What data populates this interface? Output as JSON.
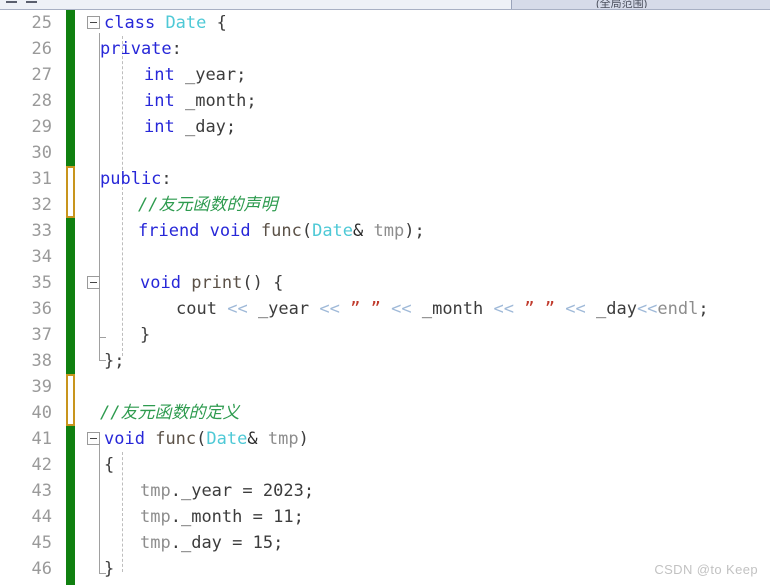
{
  "app": {
    "kind": "code-editor",
    "language": "C++",
    "watermark": "CSDN @to Keep"
  },
  "top_chrome": {
    "combo_ghost_text": "(全局范围)"
  },
  "colors": {
    "background": "#ffffff",
    "line_number": "#9a9a9a",
    "keyword": "#2727d8",
    "type": "#4ec9d6",
    "comment": "#2e9b4f",
    "string": "#c0392b",
    "operator_shift": "#9fb9d8",
    "function": "#5b5147",
    "identifier": "#3c3c3c",
    "changebar_saved": "#108010",
    "changebar_pending": "#c8951d",
    "indent_guide": "#bdbdbd",
    "watermark": "#c2c2c2"
  },
  "gutter": {
    "first_line": 25,
    "last_line": 46,
    "line_numbers": [
      25,
      26,
      27,
      28,
      29,
      30,
      31,
      32,
      33,
      34,
      35,
      36,
      37,
      38,
      39,
      40,
      41,
      42,
      43,
      44,
      45,
      46
    ]
  },
  "fold_markers": [
    {
      "line": 25,
      "state": "expanded",
      "glyph": "minus-box"
    },
    {
      "line": 35,
      "state": "expanded",
      "glyph": "minus-box"
    },
    {
      "line": 41,
      "state": "expanded",
      "glyph": "minus-box"
    }
  ],
  "change_bars": [
    {
      "from_line": 25,
      "to_line": 30,
      "state": "saved"
    },
    {
      "from_line": 31,
      "to_line": 32,
      "state": "pending"
    },
    {
      "from_line": 33,
      "to_line": 38,
      "state": "saved"
    },
    {
      "from_line": 39,
      "to_line": 40,
      "state": "pending"
    },
    {
      "from_line": 41,
      "to_line": 46,
      "state": "saved"
    }
  ],
  "lines": [
    {
      "n": 25,
      "text": "class Date {"
    },
    {
      "n": 26,
      "text": "private:"
    },
    {
      "n": 27,
      "text": "    int _year;"
    },
    {
      "n": 28,
      "text": "    int _month;"
    },
    {
      "n": 29,
      "text": "    int _day;"
    },
    {
      "n": 30,
      "text": ""
    },
    {
      "n": 31,
      "text": "public:"
    },
    {
      "n": 32,
      "text": "    //友元函数的声明"
    },
    {
      "n": 33,
      "text": "    friend void func(Date& tmp);"
    },
    {
      "n": 34,
      "text": ""
    },
    {
      "n": 35,
      "text": "    void print() {"
    },
    {
      "n": 36,
      "text": "        cout << _year << \" \" << _month << \" \" << _day<<endl;"
    },
    {
      "n": 37,
      "text": "    }"
    },
    {
      "n": 38,
      "text": "};"
    },
    {
      "n": 39,
      "text": ""
    },
    {
      "n": 40,
      "text": "//友元函数的定义"
    },
    {
      "n": 41,
      "text": "void func(Date& tmp)"
    },
    {
      "n": 42,
      "text": "{"
    },
    {
      "n": 43,
      "text": "    tmp._year = 2023;"
    },
    {
      "n": 44,
      "text": "    tmp._month = 11;"
    },
    {
      "n": 45,
      "text": "    tmp._day = 15;"
    },
    {
      "n": 46,
      "text": "}"
    }
  ],
  "tokens": {
    "kw_class": "class",
    "kw_private": "private",
    "kw_public": "public",
    "kw_int": "int",
    "kw_void": "void",
    "kw_friend": "friend",
    "type_Date": "Date",
    "fn_func": "func",
    "fn_print": "print",
    "id_cout": "cout",
    "id_endl": "endl",
    "id_tmp": "tmp",
    "field_year": "_year",
    "field_month": "_month",
    "field_day": "_day",
    "op_shift": "<<",
    "quote_open": "”",
    "quote_close": "”",
    "num_2023": "2023",
    "num_11": "11",
    "num_15": "15",
    "comment_decl": "//友元函数的声明",
    "comment_def": "//友元函数的定义"
  }
}
